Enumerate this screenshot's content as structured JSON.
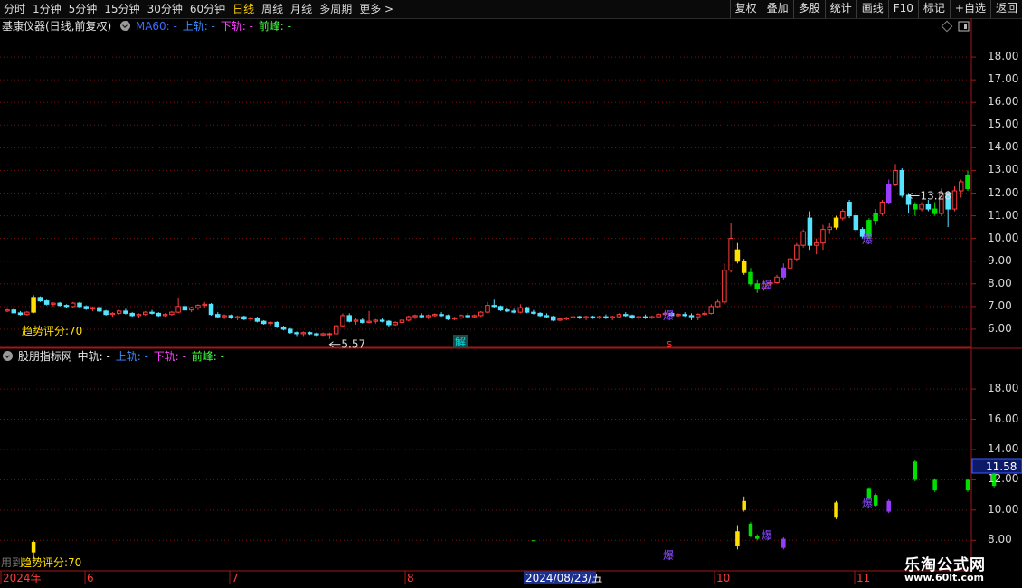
{
  "toolbar": {
    "periods": [
      {
        "label": "分时",
        "active": false
      },
      {
        "label": "1分钟",
        "active": false
      },
      {
        "label": "5分钟",
        "active": false
      },
      {
        "label": "15分钟",
        "active": false
      },
      {
        "label": "30分钟",
        "active": false
      },
      {
        "label": "60分钟",
        "active": false
      },
      {
        "label": "日线",
        "active": true
      },
      {
        "label": "周线",
        "active": false
      },
      {
        "label": "月线",
        "active": false
      },
      {
        "label": "多周期",
        "active": false
      },
      {
        "label": "更多 >",
        "active": false
      }
    ],
    "right_buttons": [
      "复权",
      "叠加",
      "多股",
      "统计",
      "画线",
      "F10",
      "标记",
      "+自选",
      "返回"
    ]
  },
  "main_chart": {
    "stock_title": "基康仪器(日线,前复权)",
    "ma_label": "MA60: -",
    "upper_label": "上轨: -",
    "lower_label": "下轨: -",
    "peak_label": "前峰: -",
    "score_text": "趋势评分:70",
    "high_marker": "13.28",
    "low_marker": "5.57",
    "markers": {
      "jie": "解",
      "s": "s",
      "bao": "爆"
    },
    "colors": {
      "up": "#ff3c3c",
      "down": "#55e3ff",
      "signal_yellow": "#ffe000",
      "signal_green": "#00e000",
      "signal_purple": "#9a3cff"
    },
    "y_ticks": [
      "18.00",
      "17.00",
      "16.00",
      "15.00",
      "14.00",
      "13.00",
      "12.00",
      "11.00",
      "10.00",
      "9.00",
      "8.00",
      "7.00",
      "6.00"
    ]
  },
  "sub_chart": {
    "title": "股朋指标网",
    "mid_label": "中轨: -",
    "upper_label": "上轨: -",
    "lower_label": "下轨: -",
    "peak_label": "前峰: -",
    "score_text": "趋势评分:70",
    "score_prefix": "用到",
    "last_value": "11.58",
    "y_ticks": [
      "18.00",
      "16.00",
      "14.00",
      "12.00",
      "10.00",
      "8.00"
    ]
  },
  "x_axis": {
    "labels": [
      "2024年",
      "6",
      "7",
      "8",
      "10",
      "11"
    ],
    "crosshair_date": "2024/08/23/五"
  },
  "watermark": {
    "name": "乐淘公式网",
    "url": "www.60lt.com"
  },
  "chart_data": {
    "type": "candlestick",
    "ylim_main": [
      5.2,
      19.0
    ],
    "ylim_sub": [
      7.0,
      19.8
    ],
    "x": [
      "2024年",
      "6",
      "7",
      "8",
      "10",
      "11"
    ],
    "ohlc": [
      [
        6.8,
        6.9,
        6.75,
        6.85
      ],
      [
        6.85,
        6.95,
        6.7,
        6.72
      ],
      [
        6.72,
        6.8,
        6.6,
        6.65
      ],
      [
        6.65,
        6.8,
        6.6,
        6.75
      ],
      [
        6.75,
        7.5,
        6.7,
        7.4
      ],
      [
        7.4,
        7.45,
        7.2,
        7.25
      ],
      [
        7.25,
        7.3,
        7.05,
        7.1
      ],
      [
        7.1,
        7.2,
        7.0,
        7.15
      ],
      [
        7.15,
        7.2,
        7.0,
        7.05
      ],
      [
        7.05,
        7.1,
        6.95,
        7.0
      ],
      [
        7.0,
        7.2,
        6.95,
        7.15
      ],
      [
        7.15,
        7.2,
        6.95,
        7.0
      ],
      [
        7.0,
        7.05,
        6.85,
        6.9
      ],
      [
        6.9,
        7.0,
        6.8,
        6.95
      ],
      [
        6.95,
        7.0,
        6.75,
        6.8
      ],
      [
        6.8,
        6.85,
        6.6,
        6.65
      ],
      [
        6.65,
        6.75,
        6.55,
        6.7
      ],
      [
        6.7,
        6.85,
        6.65,
        6.8
      ],
      [
        6.8,
        6.9,
        6.65,
        6.7
      ],
      [
        6.7,
        6.75,
        6.55,
        6.6
      ],
      [
        6.6,
        6.7,
        6.5,
        6.65
      ],
      [
        6.65,
        6.8,
        6.6,
        6.75
      ],
      [
        6.75,
        6.85,
        6.65,
        6.7
      ],
      [
        6.7,
        6.75,
        6.55,
        6.6
      ],
      [
        6.6,
        6.7,
        6.55,
        6.65
      ],
      [
        6.65,
        6.8,
        6.6,
        6.75
      ],
      [
        6.75,
        7.4,
        6.7,
        7.0
      ],
      [
        7.0,
        7.1,
        6.8,
        6.85
      ],
      [
        6.85,
        7.0,
        6.75,
        6.95
      ],
      [
        6.95,
        7.1,
        6.85,
        7.05
      ],
      [
        7.05,
        7.2,
        6.95,
        7.1
      ],
      [
        7.1,
        7.15,
        6.6,
        6.65
      ],
      [
        6.65,
        6.75,
        6.5,
        6.55
      ],
      [
        6.55,
        6.65,
        6.45,
        6.6
      ],
      [
        6.6,
        6.65,
        6.45,
        6.5
      ],
      [
        6.5,
        6.6,
        6.4,
        6.55
      ],
      [
        6.55,
        6.6,
        6.4,
        6.45
      ],
      [
        6.45,
        6.55,
        6.35,
        6.5
      ],
      [
        6.5,
        6.55,
        6.3,
        6.35
      ],
      [
        6.35,
        6.4,
        6.2,
        6.25
      ],
      [
        6.25,
        6.35,
        6.15,
        6.3
      ],
      [
        6.3,
        6.35,
        6.05,
        6.1
      ],
      [
        6.1,
        6.15,
        5.95,
        6.0
      ],
      [
        6.0,
        6.05,
        5.8,
        5.85
      ],
      [
        5.85,
        5.9,
        5.7,
        5.8
      ],
      [
        5.8,
        5.9,
        5.7,
        5.85
      ],
      [
        5.85,
        5.9,
        5.75,
        5.8
      ],
      [
        5.8,
        5.85,
        5.7,
        5.75
      ],
      [
        5.75,
        5.85,
        5.7,
        5.8
      ],
      [
        5.8,
        5.85,
        5.57,
        5.8
      ],
      [
        5.8,
        6.2,
        5.75,
        6.15
      ],
      [
        6.15,
        6.7,
        6.1,
        6.6
      ],
      [
        6.6,
        6.7,
        6.3,
        6.35
      ],
      [
        6.35,
        6.5,
        6.2,
        6.4
      ],
      [
        6.4,
        6.5,
        6.25,
        6.3
      ],
      [
        6.3,
        6.8,
        6.25,
        6.35
      ],
      [
        6.35,
        6.45,
        6.25,
        6.4
      ],
      [
        6.4,
        6.5,
        6.3,
        6.35
      ],
      [
        6.35,
        6.4,
        6.1,
        6.2
      ],
      [
        6.2,
        6.35,
        6.15,
        6.3
      ],
      [
        6.3,
        6.45,
        6.25,
        6.4
      ],
      [
        6.4,
        6.6,
        6.35,
        6.55
      ],
      [
        6.55,
        6.65,
        6.45,
        6.6
      ],
      [
        6.6,
        6.7,
        6.5,
        6.55
      ],
      [
        6.55,
        6.65,
        6.45,
        6.6
      ],
      [
        6.6,
        6.7,
        6.55,
        6.65
      ],
      [
        6.65,
        6.75,
        6.55,
        6.6
      ],
      [
        6.6,
        6.65,
        6.4,
        6.45
      ],
      [
        6.45,
        6.55,
        6.4,
        6.5
      ],
      [
        6.5,
        6.65,
        6.45,
        6.6
      ],
      [
        6.6,
        6.7,
        6.5,
        6.55
      ],
      [
        6.55,
        6.65,
        6.5,
        6.6
      ],
      [
        6.6,
        6.8,
        6.55,
        6.75
      ],
      [
        6.75,
        7.2,
        6.7,
        7.05
      ],
      [
        7.05,
        7.3,
        6.95,
        7.0
      ],
      [
        7.0,
        7.05,
        6.8,
        6.85
      ],
      [
        6.85,
        6.95,
        6.75,
        6.8
      ],
      [
        6.8,
        6.9,
        6.7,
        6.75
      ],
      [
        6.75,
        7.1,
        6.7,
        6.95
      ],
      [
        6.95,
        7.0,
        6.7,
        6.75
      ],
      [
        6.75,
        6.85,
        6.65,
        6.7
      ],
      [
        6.7,
        6.75,
        6.55,
        6.6
      ],
      [
        6.6,
        6.7,
        6.5,
        6.55
      ],
      [
        6.55,
        6.6,
        6.35,
        6.4
      ],
      [
        6.4,
        6.5,
        6.35,
        6.45
      ],
      [
        6.45,
        6.55,
        6.4,
        6.5
      ],
      [
        6.5,
        6.6,
        6.4,
        6.55
      ],
      [
        6.55,
        6.6,
        6.45,
        6.5
      ],
      [
        6.5,
        6.6,
        6.4,
        6.55
      ],
      [
        6.55,
        6.6,
        6.45,
        6.5
      ],
      [
        6.5,
        6.6,
        6.45,
        6.55
      ],
      [
        6.55,
        6.65,
        6.45,
        6.5
      ],
      [
        6.5,
        6.6,
        6.4,
        6.55
      ],
      [
        6.55,
        6.7,
        6.5,
        6.65
      ],
      [
        6.65,
        6.75,
        6.55,
        6.6
      ],
      [
        6.6,
        6.65,
        6.45,
        6.5
      ],
      [
        6.5,
        6.6,
        6.4,
        6.55
      ],
      [
        6.55,
        6.65,
        6.45,
        6.5
      ],
      [
        6.5,
        6.6,
        6.45,
        6.55
      ],
      [
        6.55,
        6.7,
        6.5,
        6.65
      ],
      [
        6.65,
        6.8,
        6.6,
        6.7
      ],
      [
        6.7,
        6.75,
        6.55,
        6.6
      ],
      [
        6.6,
        6.7,
        6.55,
        6.65
      ],
      [
        6.65,
        6.75,
        6.55,
        6.6
      ],
      [
        6.6,
        6.7,
        6.4,
        6.55
      ],
      [
        6.55,
        6.7,
        6.4,
        6.65
      ],
      [
        6.65,
        6.8,
        6.6,
        6.7
      ],
      [
        6.7,
        7.1,
        6.65,
        7.0
      ],
      [
        7.0,
        7.3,
        6.95,
        7.2
      ],
      [
        7.2,
        8.9,
        7.1,
        8.6
      ],
      [
        8.6,
        10.7,
        8.5,
        10.0
      ],
      [
        9.5,
        9.8,
        8.9,
        9.0
      ],
      [
        9.0,
        9.1,
        8.4,
        8.5
      ],
      [
        8.5,
        8.7,
        7.9,
        8.0
      ],
      [
        8.0,
        8.2,
        7.6,
        7.8
      ],
      [
        7.8,
        8.1,
        7.7,
        8.0
      ],
      [
        8.0,
        8.2,
        7.9,
        8.05
      ],
      [
        8.05,
        8.4,
        8.0,
        8.3
      ],
      [
        8.3,
        8.9,
        8.2,
        8.7
      ],
      [
        8.7,
        9.2,
        8.6,
        9.1
      ],
      [
        9.1,
        9.8,
        9.0,
        9.7
      ],
      [
        9.7,
        10.4,
        9.6,
        10.3
      ],
      [
        10.9,
        11.2,
        9.5,
        9.7
      ],
      [
        9.7,
        10.0,
        9.3,
        9.8
      ],
      [
        9.8,
        10.6,
        9.5,
        10.4
      ],
      [
        10.4,
        10.7,
        10.2,
        10.5
      ],
      [
        10.5,
        11.0,
        10.4,
        10.9
      ],
      [
        10.9,
        11.3,
        10.8,
        11.2
      ],
      [
        11.6,
        11.7,
        10.9,
        11.0
      ],
      [
        11.0,
        11.1,
        10.3,
        10.4
      ],
      [
        10.4,
        10.5,
        10.0,
        10.1
      ],
      [
        10.1,
        10.9,
        10.0,
        10.8
      ],
      [
        10.8,
        11.3,
        10.6,
        11.1
      ],
      [
        11.1,
        11.7,
        11.0,
        11.6
      ],
      [
        11.6,
        12.6,
        11.5,
        12.4
      ],
      [
        12.4,
        13.28,
        12.3,
        13.0
      ],
      [
        13.0,
        13.1,
        11.8,
        11.9
      ],
      [
        11.9,
        12.0,
        11.1,
        11.5
      ],
      [
        11.5,
        11.6,
        11.0,
        11.3
      ],
      [
        11.3,
        11.6,
        11.2,
        11.5
      ],
      [
        11.5,
        11.7,
        11.2,
        11.3
      ],
      [
        11.3,
        11.6,
        11.0,
        11.1
      ],
      [
        11.1,
        12.2,
        11.0,
        12.0
      ],
      [
        12.0,
        12.1,
        10.5,
        11.3
      ],
      [
        11.3,
        12.3,
        11.2,
        12.1
      ],
      [
        12.1,
        12.6,
        11.8,
        12.5
      ],
      [
        12.8,
        13.0,
        12.1,
        12.2
      ]
    ],
    "signals_main": [
      {
        "index": 4,
        "color": "yellow"
      },
      {
        "index": 111,
        "color": "yellow"
      },
      {
        "index": 112,
        "color": "yellow"
      },
      {
        "index": 113,
        "color": "green"
      },
      {
        "index": 114,
        "color": "green"
      },
      {
        "index": 118,
        "color": "purple"
      },
      {
        "index": 126,
        "color": "yellow"
      },
      {
        "index": 131,
        "color": "green"
      },
      {
        "index": 132,
        "color": "green"
      },
      {
        "index": 134,
        "color": "purple"
      },
      {
        "index": 138,
        "color": "green"
      },
      {
        "index": 141,
        "color": "green"
      },
      {
        "index": 146,
        "color": "green"
      },
      {
        "index": 150,
        "color": "green"
      }
    ],
    "sub_bars": [
      {
        "index": 4,
        "open": 7.2,
        "close": 7.9,
        "low": 6.8,
        "high": 8.0,
        "color": "yellow"
      },
      {
        "index": 111,
        "open": 7.6,
        "close": 8.6,
        "low": 7.4,
        "high": 9.0,
        "color": "yellow"
      },
      {
        "index": 112,
        "open": 10.0,
        "close": 10.6,
        "low": 9.9,
        "high": 10.9,
        "color": "yellow"
      },
      {
        "index": 113,
        "open": 8.3,
        "close": 9.1,
        "low": 8.2,
        "high": 9.2,
        "color": "green"
      },
      {
        "index": 114,
        "open": 8.1,
        "close": 8.3,
        "low": 8.0,
        "high": 8.4,
        "color": "green"
      },
      {
        "index": 118,
        "open": 7.5,
        "close": 8.1,
        "low": 7.4,
        "high": 8.2,
        "color": "purple"
      },
      {
        "index": 126,
        "open": 9.5,
        "close": 10.5,
        "low": 9.4,
        "high": 10.6,
        "color": "yellow"
      },
      {
        "index": 131,
        "open": 10.8,
        "close": 11.4,
        "low": 10.7,
        "high": 11.5,
        "color": "green"
      },
      {
        "index": 132,
        "open": 10.3,
        "close": 11.0,
        "low": 10.2,
        "high": 11.1,
        "color": "green"
      },
      {
        "index": 134,
        "open": 9.9,
        "close": 10.6,
        "low": 9.8,
        "high": 10.7,
        "color": "purple"
      },
      {
        "index": 138,
        "open": 12.0,
        "close": 13.2,
        "low": 11.9,
        "high": 13.3,
        "color": "green"
      },
      {
        "index": 141,
        "open": 11.3,
        "close": 12.0,
        "low": 11.2,
        "high": 12.1,
        "color": "green"
      },
      {
        "index": 146,
        "open": 11.3,
        "close": 12.0,
        "low": 11.2,
        "high": 12.1,
        "color": "green"
      },
      {
        "index": 150,
        "open": 11.6,
        "close": 12.4,
        "low": 11.5,
        "high": 12.5,
        "color": "green"
      },
      {
        "index": 80,
        "open": 7.95,
        "close": 8.0,
        "low": 7.95,
        "high": 8.0,
        "color": "green"
      }
    ],
    "markers": [
      {
        "index": 49,
        "text": "5.57",
        "kind": "low"
      },
      {
        "index": 137,
        "text": "13.28",
        "kind": "high"
      }
    ]
  }
}
